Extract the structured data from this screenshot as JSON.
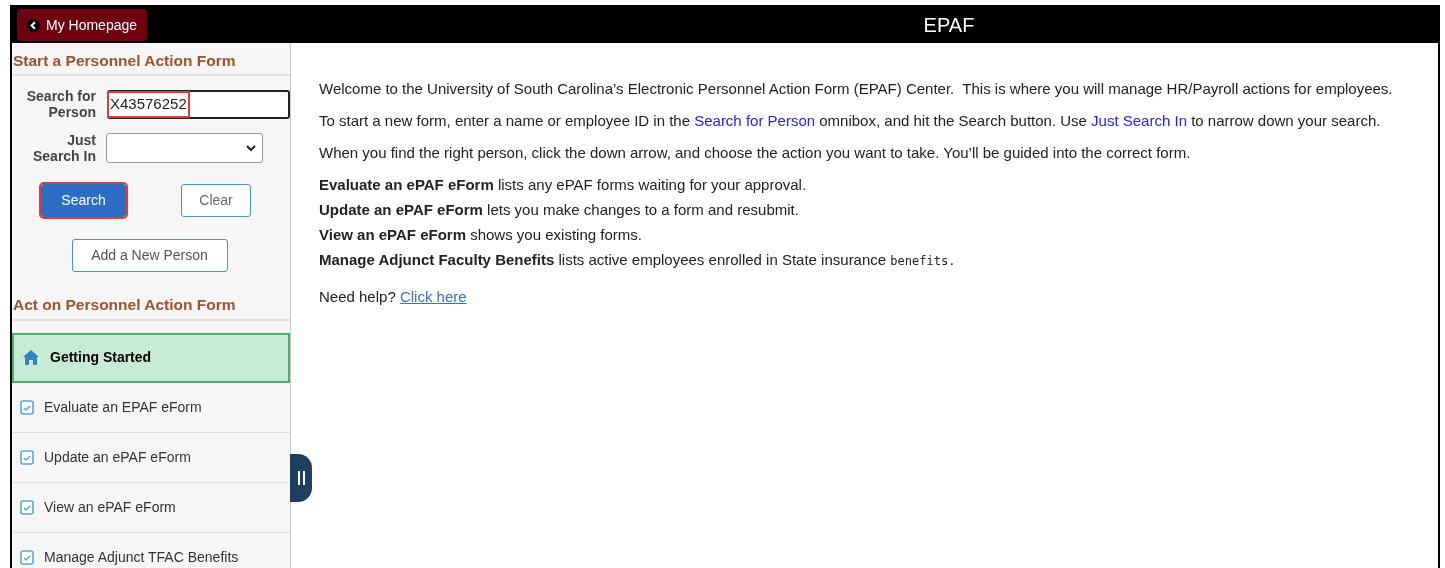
{
  "header": {
    "back_button": "My Homepage",
    "title": "EPAF"
  },
  "sidebar": {
    "search_section_title": "Start a Personnel Action Form",
    "search_field": {
      "label": "Search for Person",
      "value": "X43576252",
      "highlighted": true
    },
    "scope_field": {
      "label": "Just Search In"
    },
    "buttons": [
      {
        "label": "Search",
        "kind": "primary",
        "highlighted": true
      },
      {
        "label": "Clear",
        "kind": "secondary",
        "highlighted": false
      }
    ],
    "add_button": "Add a New Person",
    "act_section_title": "Act on Personnel Action Form",
    "items": [
      {
        "label": "Getting Started",
        "kind": "home",
        "selected": true
      },
      {
        "label": "Evaluate an EPAF eForm",
        "kind": "doc",
        "selected": false
      },
      {
        "label": "Update an ePAF eForm",
        "kind": "doc",
        "selected": false
      },
      {
        "label": "View an ePAF eForm",
        "kind": "doc",
        "selected": false
      },
      {
        "label": "Manage Adjunct TFAC Benefits",
        "kind": "doc",
        "selected": false
      }
    ]
  },
  "content": {
    "intro_paragraphs": [
      {
        "segments": [
          {
            "kind": "text",
            "text": "Welcome to the University of South Carolina’s Electronic Personnel Action Form (EPAF) Center.  This is where you will manage HR/Payroll actions for employees."
          }
        ]
      },
      {
        "segments": [
          {
            "kind": "text",
            "text": "To start a new form, enter a name or employee ID in the "
          },
          {
            "kind": "link",
            "text": "Search for Person"
          },
          {
            "kind": "text",
            "text": " omnibox, and hit the Search button. Use "
          },
          {
            "kind": "link",
            "text": "Just Search In"
          },
          {
            "kind": "text",
            "text": " to narrow down your search."
          }
        ]
      },
      {
        "segments": [
          {
            "kind": "text",
            "text": "When you find the right person, click the down arrow, and choose the action you want to take. You’ll be guided into the correct form."
          }
        ]
      }
    ],
    "feature_lines": [
      {
        "segments": [
          {
            "kind": "text",
            "text": "**Evaluate an ePAF eForm** lists any ePAF forms waiting for your approval."
          }
        ]
      },
      {
        "segments": [
          {
            "kind": "text",
            "text": "**Update an ePAF eForm** lets you make changes to a form and resubmit."
          }
        ]
      },
      {
        "segments": [
          {
            "kind": "text",
            "text": "**View an ePAF eForm** shows you existing forms."
          }
        ]
      },
      {
        "segments": [
          {
            "kind": "text",
            "text": "**Manage Adjunct Faculty Benefits** lists active employees enrolled in State insurance "
          },
          {
            "kind": "mono",
            "text": "benefits."
          }
        ]
      }
    ],
    "help": {
      "segments": [
        {
          "kind": "text",
          "text": "Need help? "
        },
        {
          "kind": "help_link",
          "text": "Click here"
        }
      ]
    }
  }
}
